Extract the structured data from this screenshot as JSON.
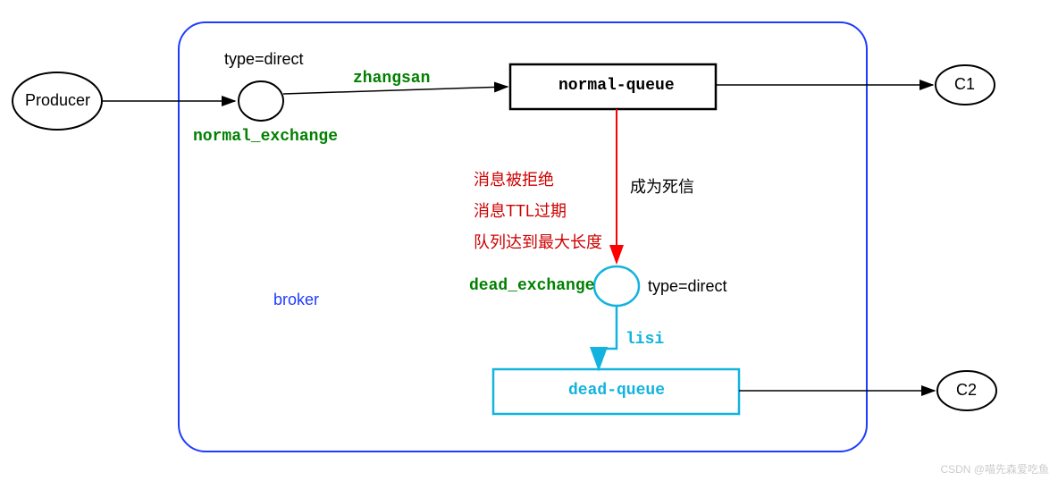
{
  "producer": {
    "label": "Producer"
  },
  "broker": {
    "label": "broker"
  },
  "normal_exchange": {
    "type_label": "type=direct",
    "name": "normal_exchange",
    "routing_key": "zhangsan"
  },
  "normal_queue": {
    "name": "normal-queue"
  },
  "dead_letter_reasons": {
    "line1": "消息被拒绝",
    "line2": "消息TTL过期",
    "line3": "队列达到最大长度",
    "become_label": "成为死信"
  },
  "dead_exchange": {
    "name": "dead_exchange",
    "type_label": "type=direct",
    "routing_key": "lisi"
  },
  "dead_queue": {
    "name": "dead-queue"
  },
  "consumers": {
    "c1": "C1",
    "c2": "C2"
  },
  "watermark": "CSDN @喵先森爱吃鱼"
}
